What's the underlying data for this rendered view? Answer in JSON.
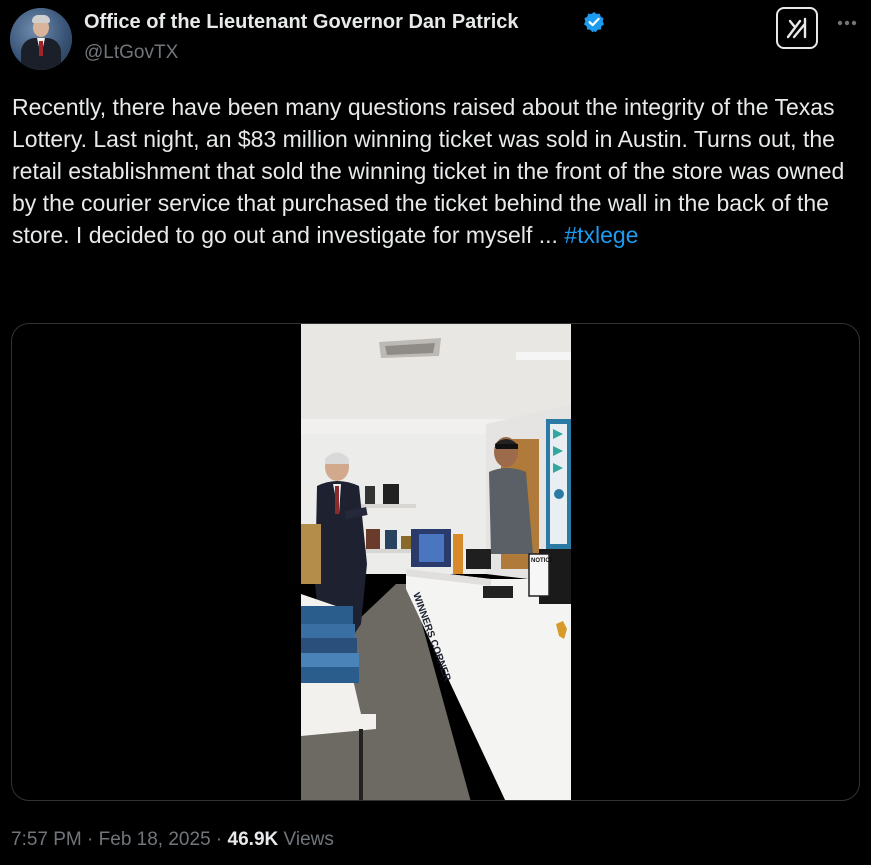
{
  "author": {
    "display_name": "Office of the Lieutenant Governor Dan Patrick",
    "handle": "@LtGovTX",
    "verified_icon": "verified-badge-icon",
    "badge_color": "#1d9bf0"
  },
  "actions": {
    "grok_icon": "grok-icon",
    "more_icon": "more-options-icon"
  },
  "tweet": {
    "text": "Recently, there have been many questions raised about the integrity of the Texas Lottery. Last night, an $83 million winning ticket was sold in Austin. Turns out, the retail establishment that sold the winning ticket in the front of the store was owned by the courier service that purchased the ticket behind the wall in the back of the store. I decided to go out and investigate for myself ...",
    "hashtag": "#txlege",
    "link_color": "#1d9bf0"
  },
  "media": {
    "store_signage": "WINNERS CORNER",
    "notice_sign": "NOTICE"
  },
  "meta": {
    "time": "7:57 PM",
    "sep1": " · ",
    "date": "Feb 18, 2025",
    "sep2": " · ",
    "views_count": "46.9K",
    "views_label": " Views"
  }
}
